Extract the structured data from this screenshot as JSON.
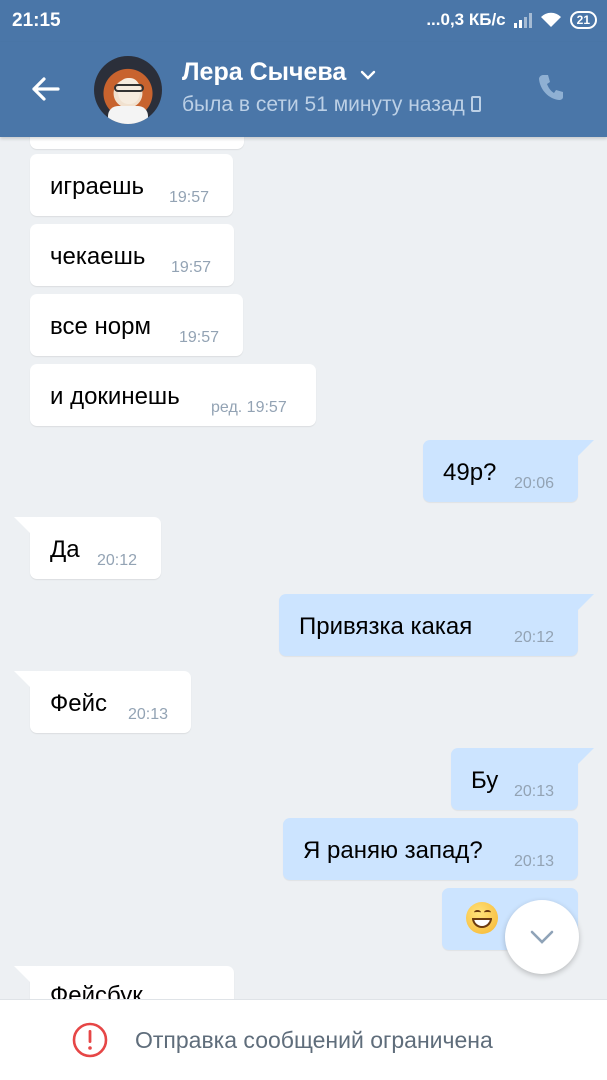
{
  "status_bar": {
    "time": "21:15",
    "network": "...0,3 КБ/с",
    "battery": "21"
  },
  "header": {
    "name": "Лера Сычева",
    "status": "была в сети 51 минуту назад"
  },
  "messages": [
    {
      "dir": "in",
      "text": "",
      "time": ""
    },
    {
      "dir": "in",
      "text": "играешь",
      "time": "19:57"
    },
    {
      "dir": "in",
      "text": "чекаешь",
      "time": "19:57"
    },
    {
      "dir": "in",
      "text": "все норм",
      "time": "19:57"
    },
    {
      "dir": "in",
      "text": "и докинешь",
      "time": "ред. 19:57"
    },
    {
      "dir": "out",
      "text": "49р?",
      "time": "20:06"
    },
    {
      "dir": "in",
      "text": "Да",
      "time": "20:12"
    },
    {
      "dir": "out",
      "text": "Привязка какая",
      "time": "20:12"
    },
    {
      "dir": "in",
      "text": "Фейс",
      "time": "20:13"
    },
    {
      "dir": "out",
      "text": "Бу",
      "time": "20:13"
    },
    {
      "dir": "out",
      "text": "Я раняю запад?",
      "time": "20:13"
    },
    {
      "dir": "out",
      "text": "",
      "emoji": "grinning-face",
      "time": ""
    },
    {
      "dir": "in",
      "text": "Фейсбук",
      "time": ""
    }
  ],
  "footer": {
    "notice": "Отправка сообщений ограничена"
  },
  "colors": {
    "header": "#4a76a8",
    "incoming": "#ffffff",
    "outgoing": "#cce4ff",
    "background": "#edf0f3",
    "warning": "#e64646"
  }
}
